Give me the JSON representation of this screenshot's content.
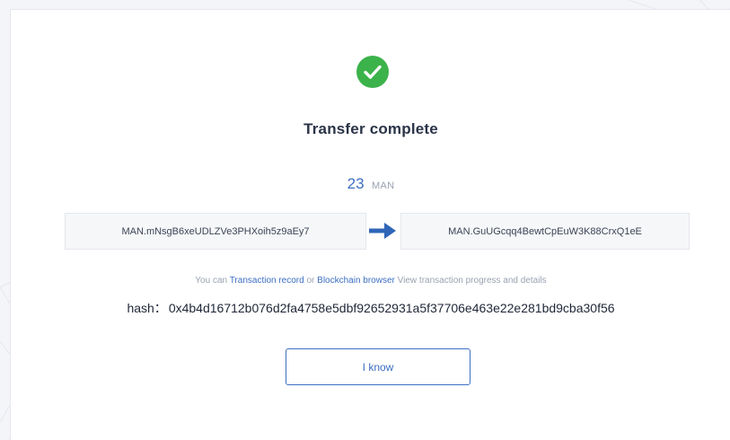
{
  "dialog": {
    "title": "Transfer complete",
    "amount": {
      "value": "23",
      "unit": "MAN"
    },
    "from_address": "MAN.mNsgB6xeUDLZVe3PHXoih5z9aEy7",
    "to_address": "MAN.GuUGcqq4BewtCpEuW3K88CrxQ1eE",
    "hint": {
      "prefix": "You can",
      "link_record": "Transaction record",
      "or": "or",
      "link_browser": "Blockchain browser",
      "suffix": "View transaction progress and details"
    },
    "hash": {
      "label": "hash：",
      "value": "0x4b4d16712b076d2fa4758e5dbf92652931a5f37706e463e22e281bd9cba30f56"
    },
    "confirm_button": "I know"
  },
  "colors": {
    "success": "#3bb24a",
    "accent": "#3d6fc2",
    "arrow": "#2f66b8",
    "title_text": "#2a3347",
    "muted_text": "#9aa2b1"
  },
  "icons": {
    "status": "check-circle-icon",
    "direction": "arrow-right-icon"
  }
}
